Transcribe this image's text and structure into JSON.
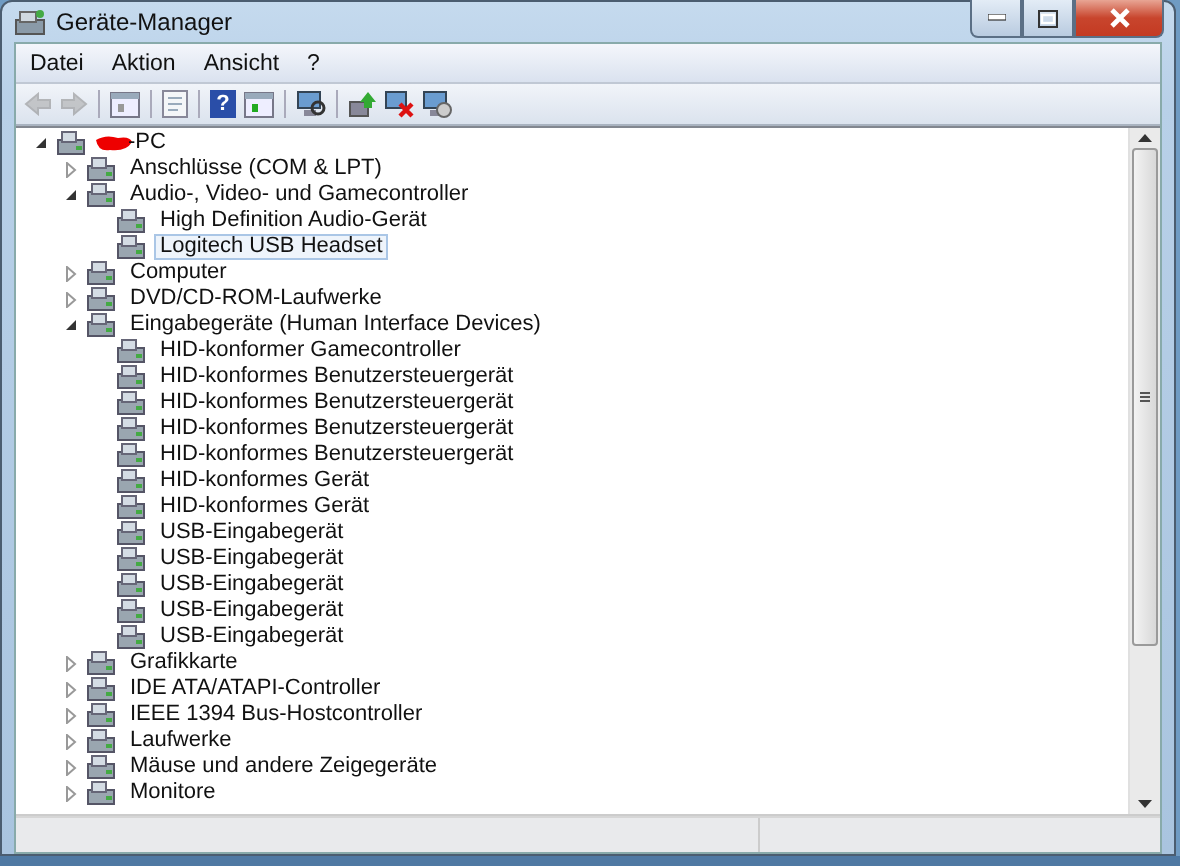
{
  "window": {
    "title": "Geräte-Manager"
  },
  "menu": [
    "Datei",
    "Aktion",
    "Ansicht",
    "?"
  ],
  "toolbar": [
    {
      "kind": "back",
      "disabled": true
    },
    {
      "kind": "forward",
      "disabled": true
    },
    {
      "kind": "sep"
    },
    {
      "kind": "console",
      "disabled": false
    },
    {
      "kind": "sep"
    },
    {
      "kind": "properties",
      "disabled": false
    },
    {
      "kind": "sep"
    },
    {
      "kind": "help",
      "glyph": "?",
      "disabled": false
    },
    {
      "kind": "pane",
      "disabled": false
    },
    {
      "kind": "sep"
    },
    {
      "kind": "scan",
      "disabled": false
    },
    {
      "kind": "sep"
    },
    {
      "kind": "update",
      "disabled": false
    },
    {
      "kind": "uninstall",
      "disabled": false
    },
    {
      "kind": "enable",
      "disabled": false
    }
  ],
  "tree": [
    {
      "label": "-PC",
      "redacted": true,
      "expanded": true,
      "selected": false,
      "children": [
        {
          "label": "Anschlüsse (COM & LPT)",
          "expanded": false,
          "selected": false
        },
        {
          "label": "Audio-, Video- und Gamecontroller",
          "expanded": true,
          "selected": false,
          "children": [
            {
              "label": "High Definition Audio-Gerät",
              "selected": false
            },
            {
              "label": "Logitech USB Headset",
              "selected": true
            }
          ]
        },
        {
          "label": "Computer",
          "expanded": false,
          "selected": false
        },
        {
          "label": "DVD/CD-ROM-Laufwerke",
          "expanded": false,
          "selected": false
        },
        {
          "label": "Eingabegeräte (Human Interface Devices)",
          "expanded": true,
          "selected": false,
          "children": [
            {
              "label": "HID-konformer Gamecontroller",
              "selected": false
            },
            {
              "label": "HID-konformes Benutzersteuergerät",
              "selected": false
            },
            {
              "label": "HID-konformes Benutzersteuergerät",
              "selected": false
            },
            {
              "label": "HID-konformes Benutzersteuergerät",
              "selected": false
            },
            {
              "label": "HID-konformes Benutzersteuergerät",
              "selected": false
            },
            {
              "label": "HID-konformes Gerät",
              "selected": false
            },
            {
              "label": "HID-konformes Gerät",
              "selected": false
            },
            {
              "label": "USB-Eingabegerät",
              "selected": false
            },
            {
              "label": "USB-Eingabegerät",
              "selected": false
            },
            {
              "label": "USB-Eingabegerät",
              "selected": false
            },
            {
              "label": "USB-Eingabegerät",
              "selected": false
            },
            {
              "label": "USB-Eingabegerät",
              "selected": false
            }
          ]
        },
        {
          "label": "Grafikkarte",
          "expanded": false,
          "selected": false
        },
        {
          "label": "IDE ATA/ATAPI-Controller",
          "expanded": false,
          "selected": false
        },
        {
          "label": "IEEE 1394 Bus-Hostcontroller",
          "expanded": false,
          "selected": false
        },
        {
          "label": "Laufwerke",
          "expanded": false,
          "selected": false
        },
        {
          "label": "Mäuse und andere Zeigegeräte",
          "expanded": false,
          "selected": false
        },
        {
          "label": "Monitore",
          "expanded": false,
          "selected": false
        }
      ]
    }
  ]
}
